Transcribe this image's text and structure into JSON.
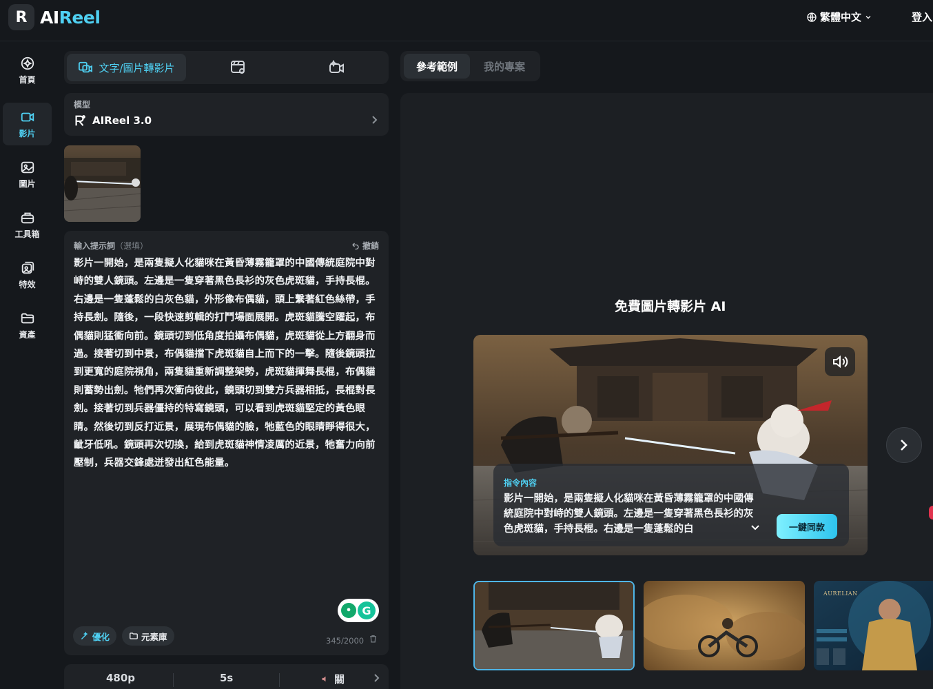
{
  "app": {
    "logo_mark": "R",
    "logo_text_a": "AI",
    "logo_text_b": "Reel"
  },
  "header": {
    "language": "繁體中文",
    "login": "登入"
  },
  "sidebar": {
    "items": [
      {
        "label": "首頁",
        "icon": "home-icon"
      },
      {
        "label": "影片",
        "icon": "video-icon",
        "active": true
      },
      {
        "label": "圖片",
        "icon": "image-icon"
      },
      {
        "label": "工具箱",
        "icon": "toolbox-icon"
      },
      {
        "label": "特效",
        "icon": "effects-icon"
      },
      {
        "label": "資產",
        "icon": "folder-icon"
      }
    ]
  },
  "mode_tabs": {
    "text_image_to_video": "文字/圖片轉影片"
  },
  "model": {
    "label": "模型",
    "value": "AIReel 3.0"
  },
  "prompt": {
    "label": "輸入提示詞",
    "optional": "（選填）",
    "undo": "撤銷",
    "text": "影片一開始，是兩隻擬人化貓咪在黃昏薄霧籠罩的中國傳統庭院中對峙的雙人鏡頭。左邊是一隻穿著黑色長衫的灰色虎斑貓，手持長棍。右邊是一隻蓬鬆的白灰色貓，外形像布偶貓，頭上繫著紅色絲帶，手持長劍。隨後，一段快速剪輯的打鬥場面展開。虎斑貓騰空躍起，布偶貓則猛衝向前。鏡頭切到低角度拍攝布偶貓，虎斑貓從上方翻身而過。接著切到中景，布偶貓擋下虎斑貓自上而下的一擊。隨後鏡頭拉到更寬的庭院視角，兩隻貓重新調整架勢，虎斑貓揮舞長棍，布偶貓則蓄勢出劍。牠們再次衝向彼此，鏡頭切到雙方兵器相抵，長棍對長劍。接著切到兵器僵持的特寫鏡頭，可以看到虎斑貓堅定的黃色眼睛。然後切到反打近景，展現布偶貓的臉，牠藍色的眼睛睜得很大，齜牙低吼。鏡頭再次切換，給到虎斑貓神情凌厲的近景，牠奮力向前壓制，兵器交鋒處迸發出紅色能量。",
    "optimize": "優化",
    "library": "元素庫",
    "counter": "345/2000"
  },
  "settings": {
    "resolution": "480p",
    "duration": "5s",
    "sound": "關"
  },
  "right_tabs": {
    "examples": "參考範例",
    "my_projects": "我的專案"
  },
  "showcase": {
    "title": "免費圖片轉影片 AI",
    "overlay_label": "指令內容",
    "overlay_text": "影片一開始，是兩隻擬人化貓咪在黃昏薄霧籠罩的中國傳統庭院中對峙的雙人鏡頭。左邊是一隻穿著黑色長衫的灰色虎斑貓，手持長棍。右邊是一隻蓬鬆的白",
    "same_button": "一鍵同款",
    "thumb3_caption": "AURELIAN"
  },
  "colors": {
    "accent": "#4fd0f2",
    "bg": "#15181c",
    "panel": "#1f2226"
  }
}
